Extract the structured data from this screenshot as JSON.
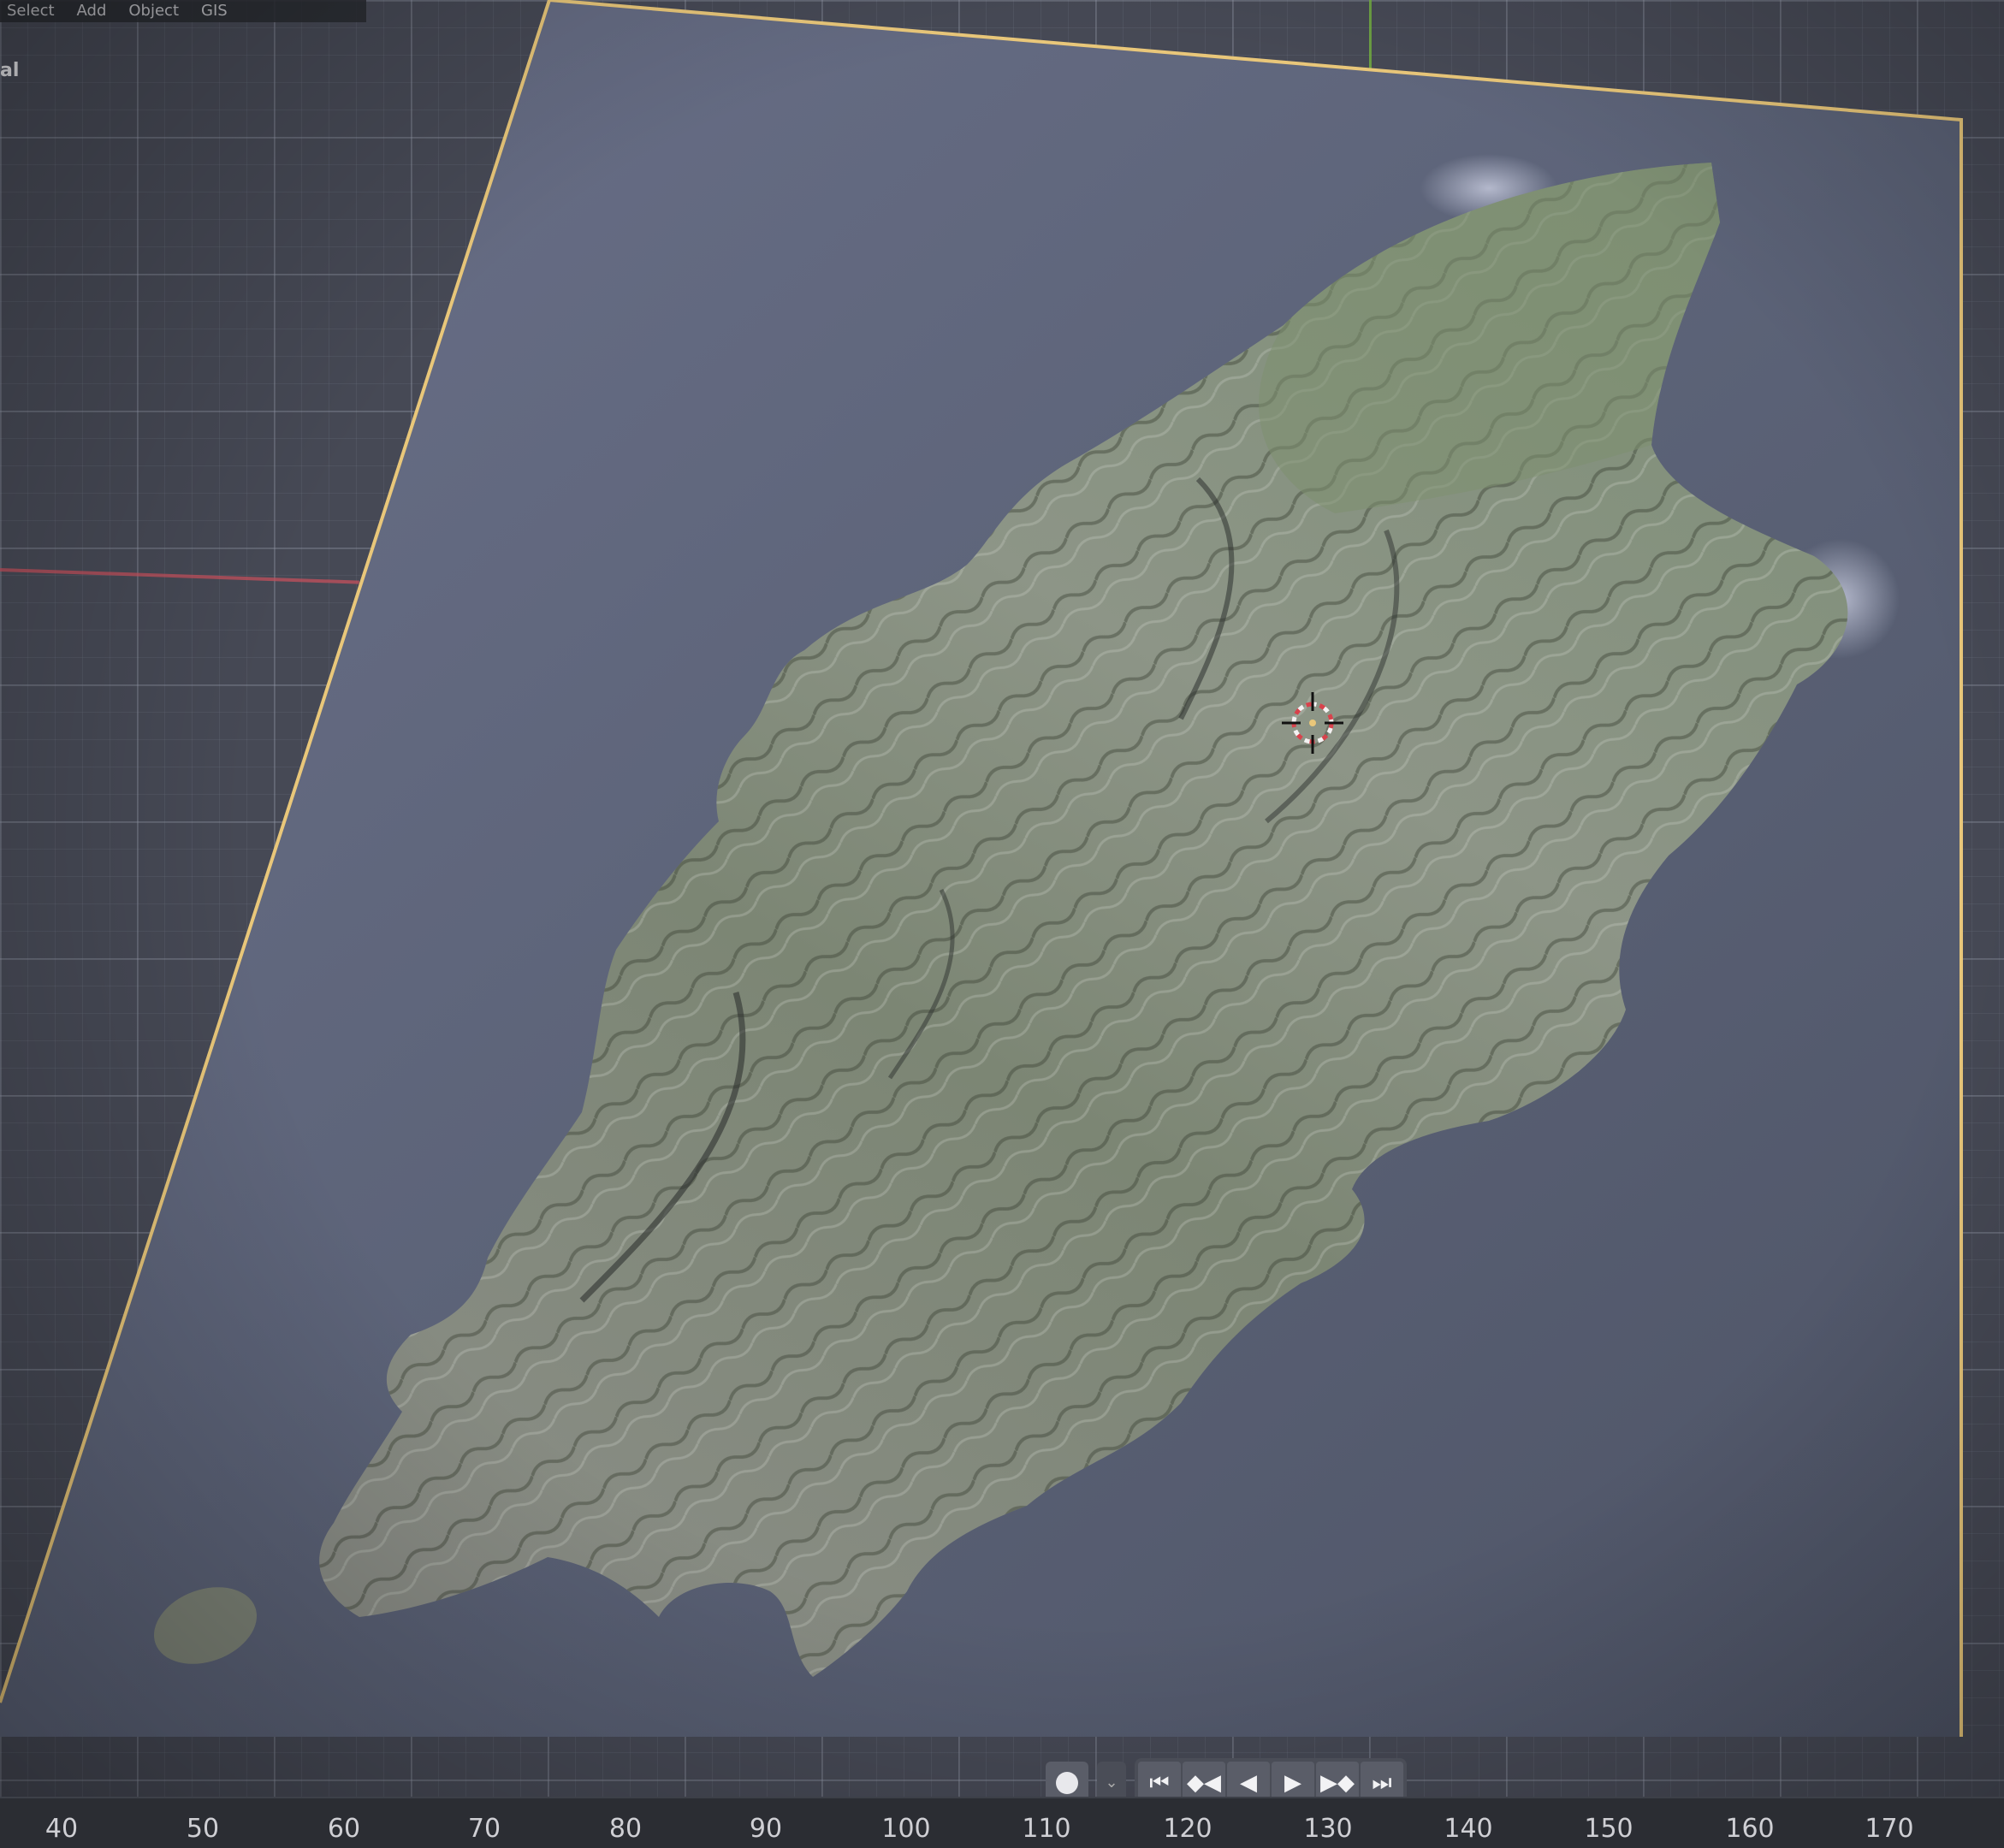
{
  "menubar": {
    "items": [
      "Select",
      "Add",
      "Object",
      "GIS"
    ]
  },
  "viewport": {
    "view_mode_label": "al",
    "colors": {
      "camera_frame": "#e9c77a",
      "ocean": "#5c6378",
      "x_axis": "#c4505c",
      "y_axis": "#6fae3a",
      "cursor_red": "#d8424c"
    },
    "icons": [
      "3d-cursor-icon"
    ]
  },
  "playback": {
    "record_icon": "record-icon",
    "dropdown_icon": "chevron-down-icon",
    "buttons": [
      {
        "name": "jump-to-start-button",
        "glyph": "⏮"
      },
      {
        "name": "jump-to-keyframe-prev-button",
        "glyph": "◆◀"
      },
      {
        "name": "play-reverse-button",
        "glyph": "◀"
      },
      {
        "name": "play-button",
        "glyph": "▶"
      },
      {
        "name": "jump-to-keyframe-next-button",
        "glyph": "▶◆"
      },
      {
        "name": "jump-to-end-button",
        "glyph": "⏭"
      }
    ]
  },
  "timeline": {
    "ticks": [
      "40",
      "50",
      "60",
      "70",
      "80",
      "90",
      "100",
      "110",
      "120",
      "130",
      "140",
      "150",
      "160",
      "170"
    ]
  }
}
